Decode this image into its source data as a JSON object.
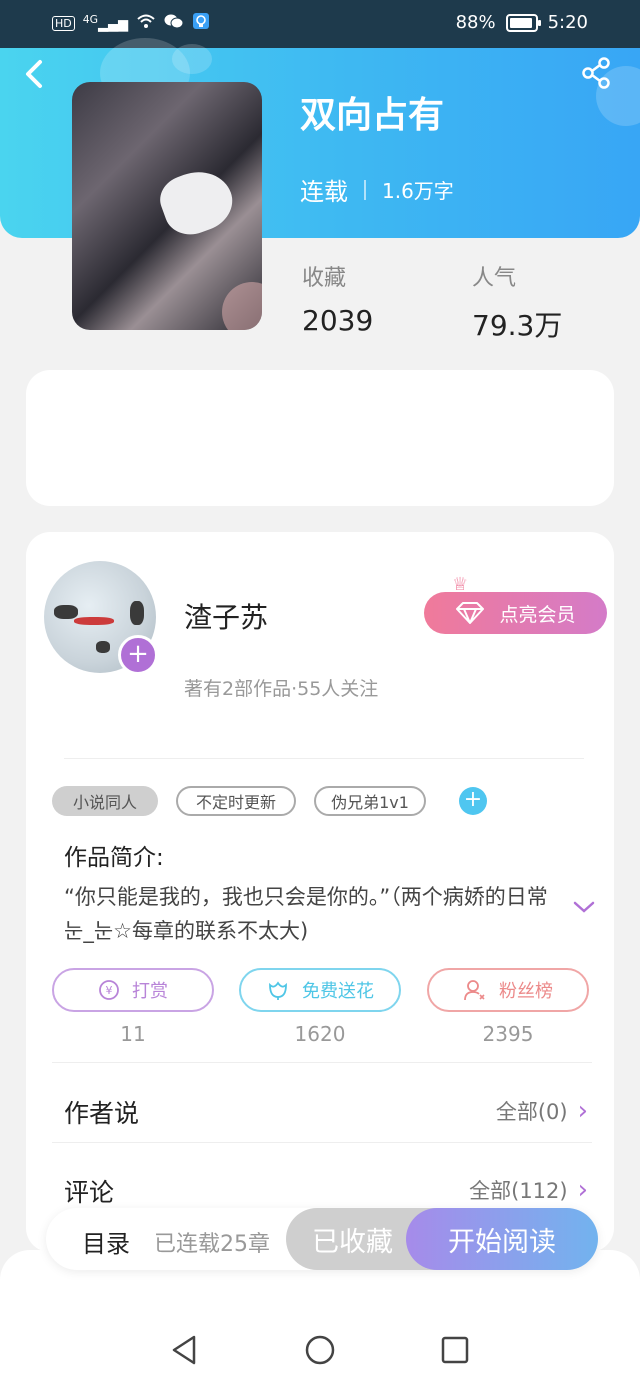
{
  "status_bar": {
    "left_icons": [
      "hd-icon",
      "signal-icon",
      "wifi-icon",
      "wechat-icon",
      "bulb-icon"
    ],
    "hd": "HD",
    "network": "4G",
    "battery": "88%",
    "time": "5:20"
  },
  "book": {
    "title": "双向占有",
    "status": "连载",
    "word_count": "1.6万字",
    "stats": [
      {
        "label": "收藏",
        "value": "2039"
      },
      {
        "label": "人气",
        "value": "79.3万"
      }
    ]
  },
  "author": {
    "name": "渣子苏",
    "stats": "著有2部作品·55人关注",
    "vip_label": "点亮会员"
  },
  "tags": [
    "小说同人",
    "不定时更新",
    "伪兄弟1v1"
  ],
  "intro": {
    "label": "作品简介:",
    "text": "“你只能是我的，我也只会是你的。”（两个病娇的日常눈_눈☆每章的联系不太大)"
  },
  "actions": [
    {
      "label": "打赏",
      "count": "11",
      "icon": "coin-icon",
      "color": "#b884d8"
    },
    {
      "label": "免费送花",
      "count": "1620",
      "icon": "flower-icon",
      "color": "#4fc6e6"
    },
    {
      "label": "粉丝榜",
      "count": "2395",
      "icon": "fan-icon",
      "color": "#ec8a8a"
    }
  ],
  "rows": [
    {
      "label": "作者说",
      "link": "全部(0)"
    },
    {
      "label": "评论",
      "link": "全部(112)"
    }
  ],
  "bottom_bar": {
    "toc": "目录",
    "toc_sub": "已连载25章",
    "fav": "已收藏",
    "read": "开始阅读"
  },
  "colors": {
    "header_start": "#4ad4ef",
    "header_end": "#38a6f5",
    "accent_purple": "#b070d6",
    "vip_start": "#f07a9a",
    "vip_end": "#d47bc8"
  }
}
